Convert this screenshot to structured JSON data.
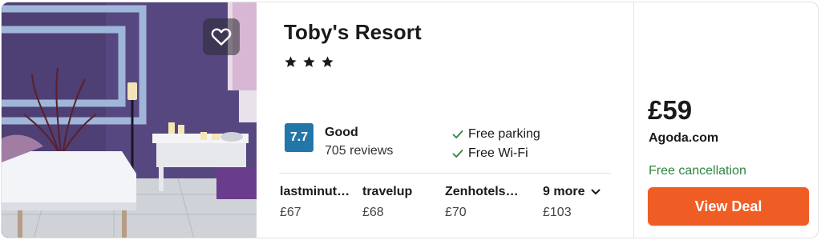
{
  "hotel": {
    "name": "Toby's Resort",
    "star_count": 3,
    "favorite_icon": "heart-outline-icon"
  },
  "rating": {
    "score": "7.7",
    "label": "Good",
    "reviews": "705 reviews",
    "badge_color": "#2377a8"
  },
  "amenities": [
    {
      "label": "Free parking",
      "icon": "check-icon"
    },
    {
      "label": "Free Wi-Fi",
      "icon": "check-icon"
    }
  ],
  "offers": [
    {
      "provider": "lastminute.com",
      "price": "£67"
    },
    {
      "provider": "travelup",
      "price": "£68"
    },
    {
      "provider": "Zenhotels.com",
      "price": "£70"
    },
    {
      "provider": "9 more",
      "price": "£103"
    }
  ],
  "deal": {
    "price": "£59",
    "provider": "Agoda.com",
    "free_cancellation": "Free cancellation",
    "button_label": "View Deal",
    "button_color": "#ef5d24",
    "cancel_color": "#2e8540"
  }
}
